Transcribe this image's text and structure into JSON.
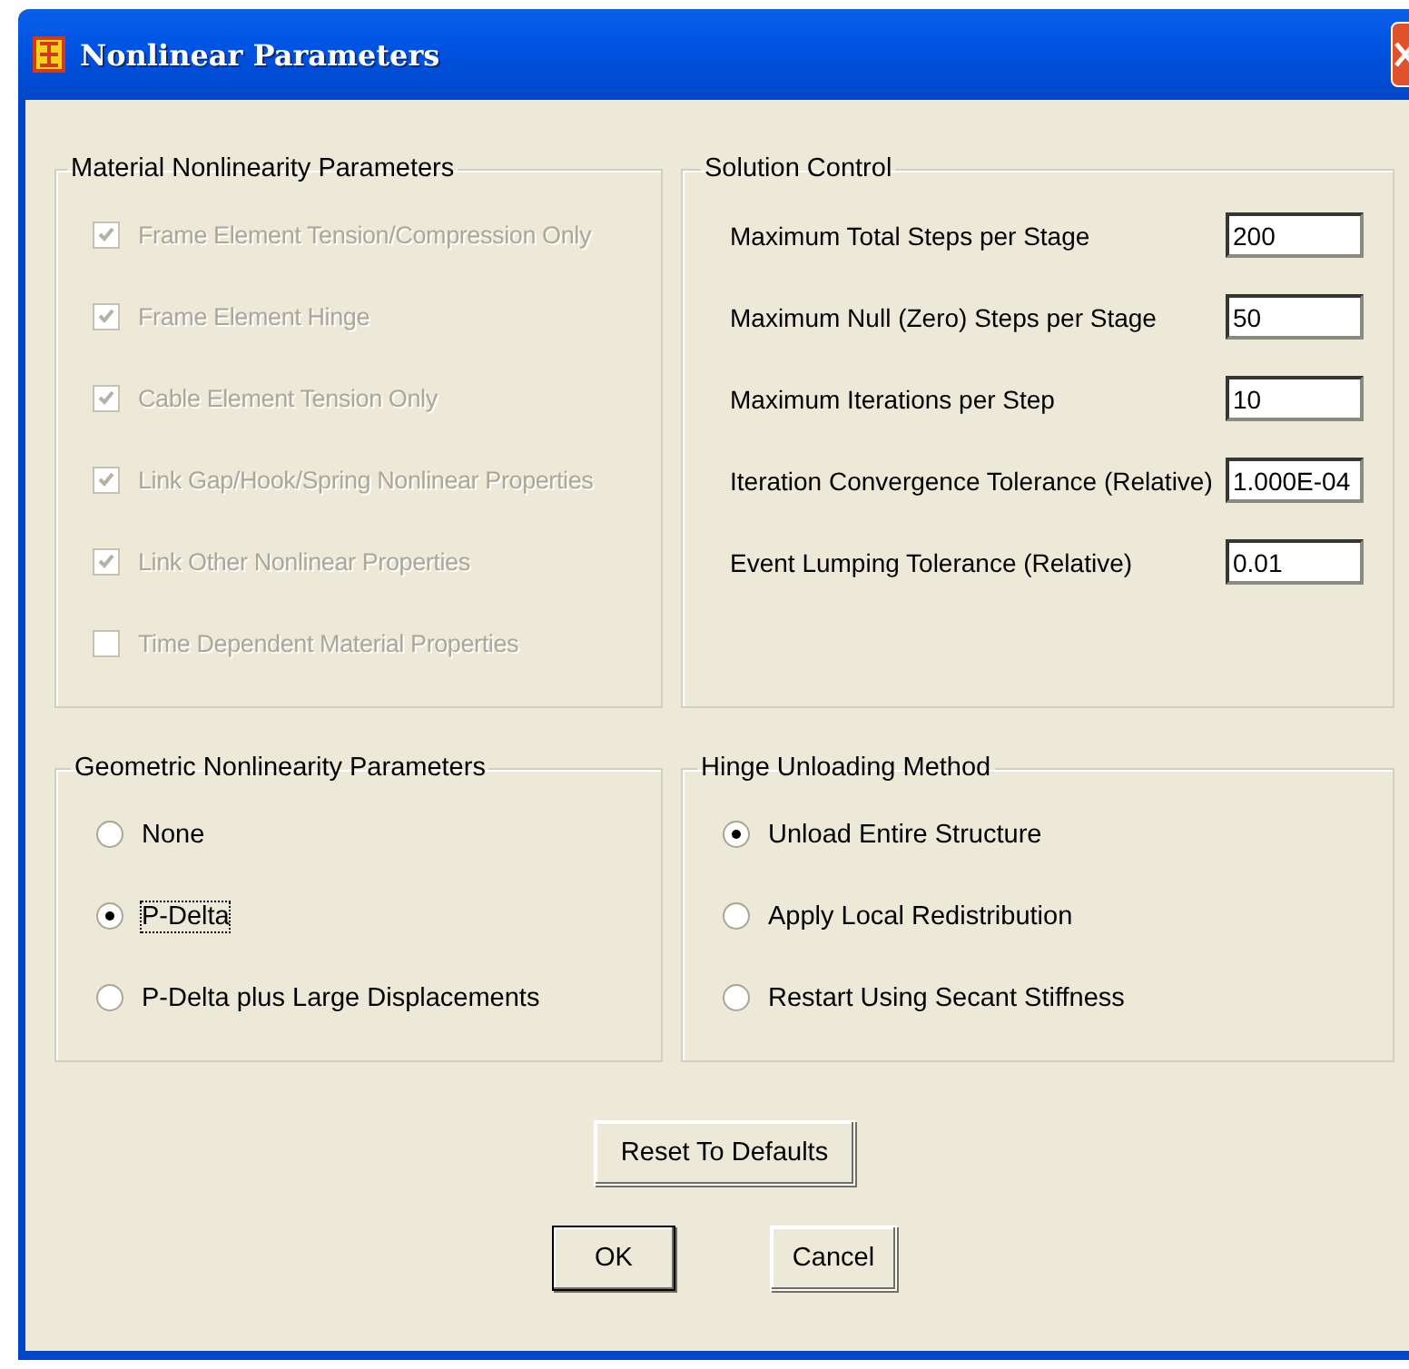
{
  "window": {
    "title": "Nonlinear Parameters"
  },
  "material": {
    "title": "Material Nonlinearity Parameters",
    "items": [
      {
        "label": "Frame Element Tension/Compression Only",
        "checked": true,
        "disabled": true
      },
      {
        "label": "Frame Element Hinge",
        "checked": true,
        "disabled": true
      },
      {
        "label": "Cable Element Tension Only",
        "checked": true,
        "disabled": true
      },
      {
        "label": "Link Gap/Hook/Spring Nonlinear Properties",
        "checked": true,
        "disabled": true
      },
      {
        "label": "Link Other Nonlinear Properties",
        "checked": true,
        "disabled": true
      },
      {
        "label": "Time Dependent Material Properties",
        "checked": false,
        "disabled": true
      }
    ]
  },
  "solution": {
    "title": "Solution Control",
    "fields": [
      {
        "label": "Maximum Total Steps per Stage",
        "value": "200"
      },
      {
        "label": "Maximum Null (Zero) Steps per Stage",
        "value": "50"
      },
      {
        "label": "Maximum Iterations per Step",
        "value": "10"
      },
      {
        "label": "Iteration Convergence Tolerance (Relative)",
        "value": "1.000E-04"
      },
      {
        "label": "Event Lumping Tolerance (Relative)",
        "value": "0.01"
      }
    ]
  },
  "geometric": {
    "title": "Geometric Nonlinearity Parameters",
    "options": [
      {
        "label": "None",
        "selected": false,
        "focused": false
      },
      {
        "label": "P-Delta",
        "selected": true,
        "focused": true
      },
      {
        "label": "P-Delta plus Large Displacements",
        "selected": false,
        "focused": false
      }
    ]
  },
  "hinge": {
    "title": "Hinge Unloading Method",
    "options": [
      {
        "label": "Unload Entire Structure",
        "selected": true,
        "focused": false
      },
      {
        "label": "Apply Local Redistribution",
        "selected": false,
        "focused": false
      },
      {
        "label": "Restart Using Secant Stiffness",
        "selected": false,
        "focused": false
      }
    ]
  },
  "buttons": {
    "reset": "Reset To Defaults",
    "ok": "OK",
    "cancel": "Cancel"
  }
}
